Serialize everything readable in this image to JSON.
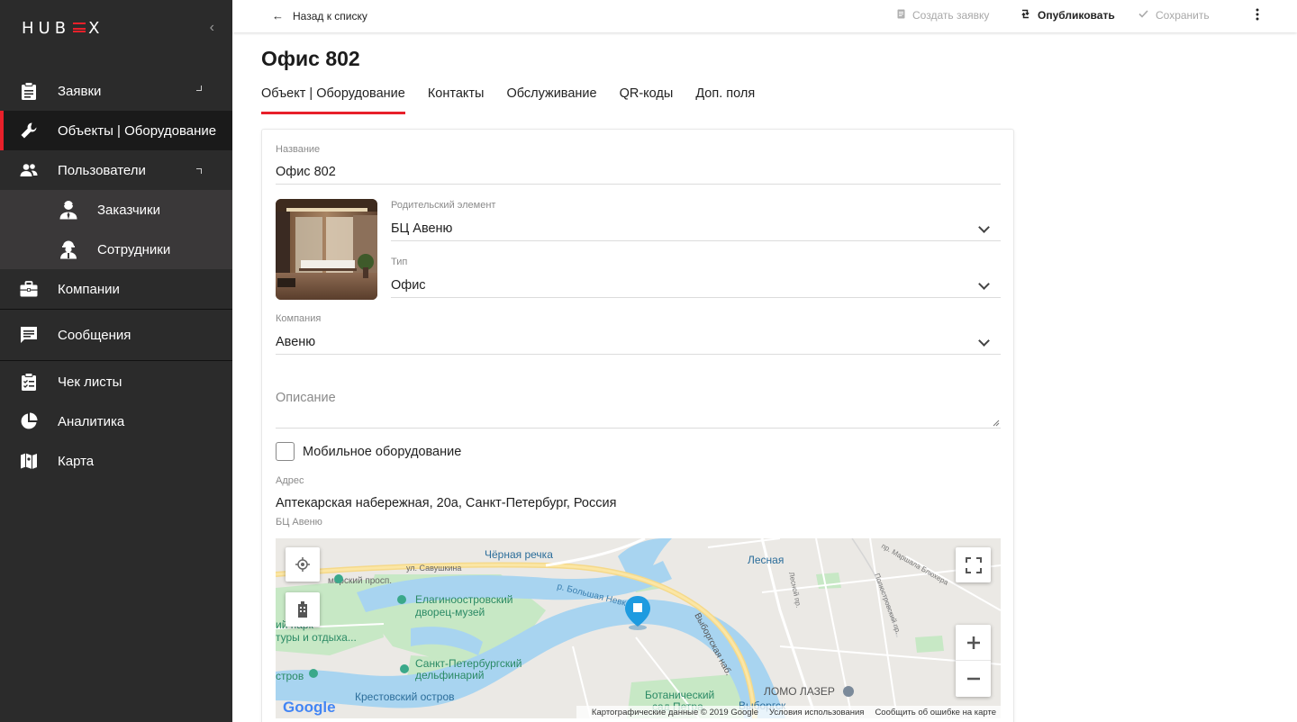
{
  "app": {
    "logo": "HUBEX",
    "collapse_icon": "chevron-left-icon"
  },
  "sidebar": {
    "items": [
      {
        "label": "Заявки",
        "icon": "clipboard-icon"
      },
      {
        "label": "Объекты | Оборудование",
        "icon": "wrench-icon",
        "active": true
      },
      {
        "label": "Пользователи",
        "icon": "users-icon"
      },
      {
        "label": "Компании",
        "icon": "briefcase-icon"
      },
      {
        "label": "Сообщения",
        "icon": "message-icon"
      },
      {
        "label": "Чек листы",
        "icon": "checklist-icon"
      },
      {
        "label": "Аналитика",
        "icon": "pie-chart-icon"
      },
      {
        "label": "Карта",
        "icon": "map-icon"
      }
    ],
    "subitems": [
      {
        "label": "Заказчики",
        "icon": "customer-icon"
      },
      {
        "label": "Сотрудники",
        "icon": "worker-icon"
      }
    ]
  },
  "topbar": {
    "back_label": "Назад к списку",
    "create_request": "Создать заявку",
    "publish": "Опубликовать",
    "save": "Сохранить"
  },
  "page": {
    "title": "Офис 802",
    "tabs": [
      "Объект | Оборудование",
      "Контакты",
      "Обслуживание",
      "QR-коды",
      "Доп. поля"
    ]
  },
  "form": {
    "name_label": "Название",
    "name_value": "Офис 802",
    "parent_label": "Родительский элемент",
    "parent_value": "БЦ Авеню",
    "type_label": "Тип",
    "type_value": "Офис",
    "company_label": "Компания",
    "company_value": "Авеню",
    "description_placeholder": "Описание",
    "mobile_label": "Мобильное оборудование",
    "mobile_checked": false,
    "address_label": "Адрес",
    "address_value": "Аптекарская набережная, 20а, Санкт-Петербург, Россия",
    "address_hint": "БЦ Авеню"
  },
  "map": {
    "labels": {
      "chernaya_rechka": "Чёрная речка",
      "lesnaya": "Лесная",
      "elagin": "Елагиноостровский",
      "elagin2": "дворец-музей",
      "park1": "ий парк",
      "park2": "туры и отдыха...",
      "dolphin1": "Санкт-Петербургский",
      "dolphin2": "дельфинарий",
      "krestovsky": "Крестовский остров",
      "botanic1": "Ботанический",
      "botanic2": "сад Петра",
      "vyborg": "Выборгск",
      "lomo": "ЛОМО ЛАЗЕР",
      "savushkina": "ул. Савушкина",
      "primorsky": "морский просп.",
      "bolshaya_nevka": "р. Большая Невка",
      "vyborg_nab": "Выборгская наб.",
      "strov": "стров",
      "lesnoy_pr": "Лесной пр.",
      "marshala": "пр. Маршала Блюхера",
      "polyustr": "Полюстровский пр.",
      "google": "Google"
    },
    "footer": {
      "data": "Картографические данные © 2019 Google",
      "terms": "Условия использования",
      "report": "Сообщить об ошибке на карте"
    }
  },
  "colors": {
    "accent": "#e8202a",
    "sidebar_bg": "#2b2b2b",
    "sidebar_active": "#1a1a1a",
    "submenu_bg": "#3a3839"
  }
}
